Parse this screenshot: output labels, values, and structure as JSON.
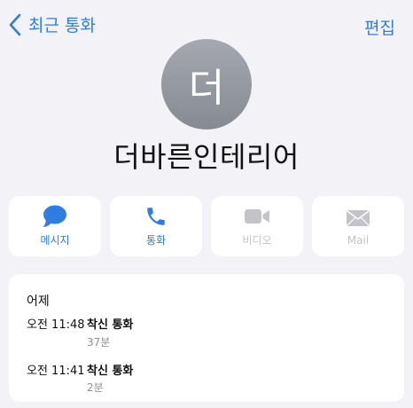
{
  "nav": {
    "back_label": "최근 통화",
    "edit_label": "편집"
  },
  "contact": {
    "avatar_initial": "더",
    "name": "더바른인테리어"
  },
  "actions": [
    {
      "label": "메시지",
      "icon": "message-bubble-icon",
      "enabled": true
    },
    {
      "label": "통화",
      "icon": "phone-icon",
      "enabled": true
    },
    {
      "label": "비디오",
      "icon": "video-camera-icon",
      "enabled": false
    },
    {
      "label": "Mail",
      "icon": "mail-envelope-icon",
      "enabled": false
    }
  ],
  "recent": {
    "day": "어제",
    "calls": [
      {
        "time": "오전 11:48",
        "type": "착신 통화",
        "duration": "37분"
      },
      {
        "time": "오전 11:41",
        "type": "착신 통화",
        "duration": "2분"
      }
    ]
  },
  "colors": {
    "accent": "#2f7de1",
    "disabled": "#c4c4c8",
    "background": "#f2f2f7"
  }
}
